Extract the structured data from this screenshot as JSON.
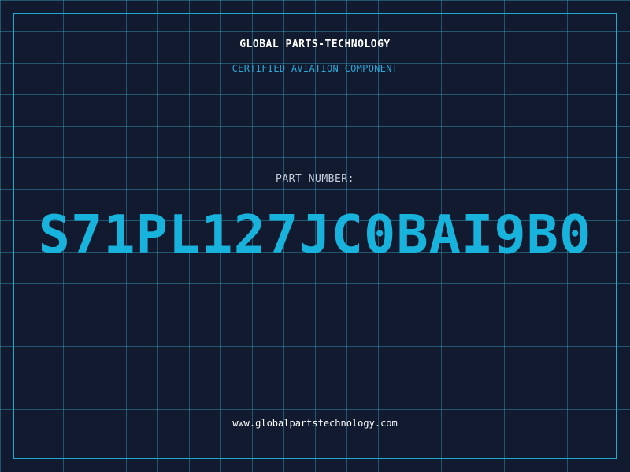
{
  "header": {
    "company": "GLOBAL PARTS-TECHNOLOGY",
    "subtitle": "CERTIFIED AVIATION COMPONENT"
  },
  "part": {
    "label": "PART NUMBER:",
    "number": "S71PL127JC0BAI9B0"
  },
  "footer": {
    "website": "www.globalpartstechnology.com"
  },
  "colors": {
    "background": "#111a2e",
    "grid": "#38aac8",
    "frame": "#1fa9cf",
    "accent": "#18b3dd",
    "subtitle": "#2ba8d8",
    "text": "#ffffff"
  }
}
